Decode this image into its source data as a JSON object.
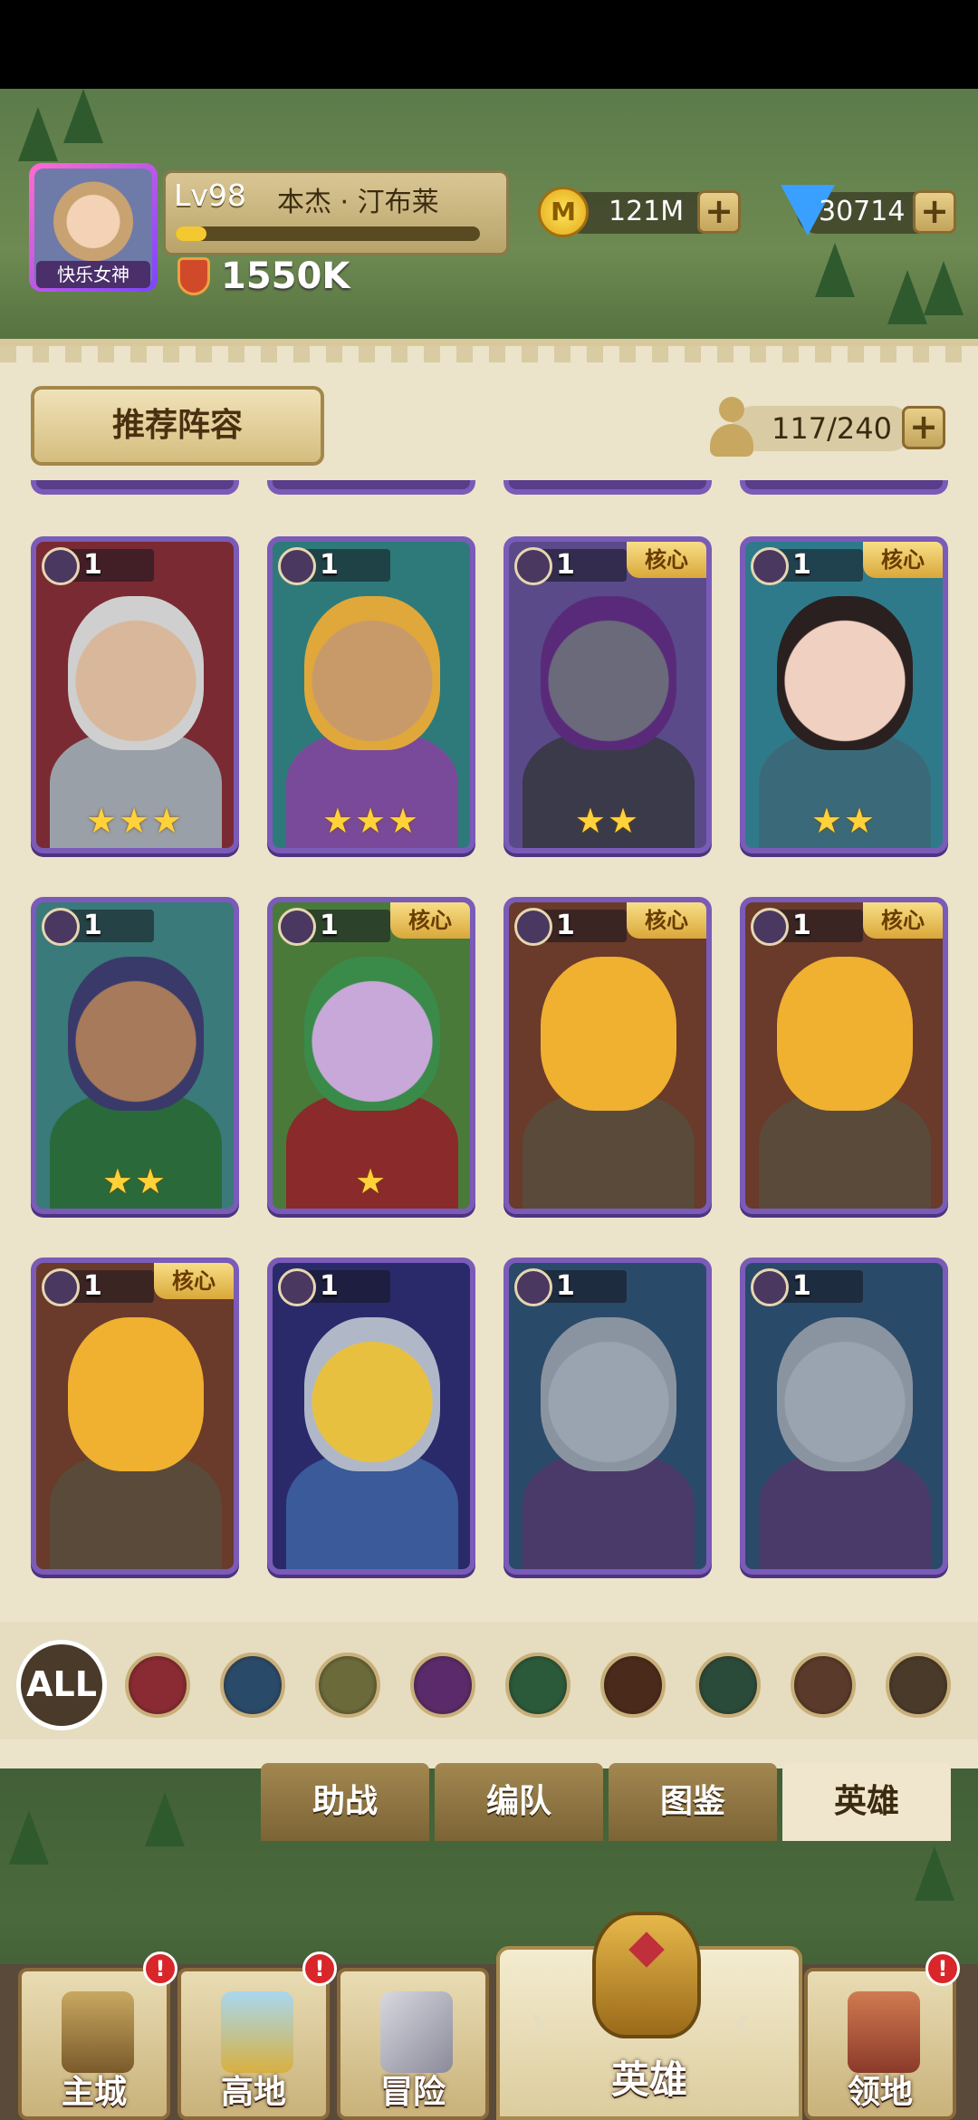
{
  "player": {
    "avatar_label": "快乐女神",
    "level": "Lv98",
    "name": "本杰 · 汀布莱",
    "xp_fraction": 0.1,
    "power": "1550K"
  },
  "resources": {
    "gold": "121M",
    "gold_icon_letter": "M",
    "gems": "30714",
    "plus": "+"
  },
  "panel": {
    "recommend_label": "推荐阵容",
    "hero_count": "117/240",
    "plus": "+"
  },
  "heroes": [
    {
      "level": "1",
      "class_icon": "shield-icon",
      "core": "",
      "stars": "★★★",
      "portrait": "grey-haired-knight",
      "bg": "#7a2a32",
      "skin": "#d8b79a",
      "outfit": "#9aa0a8",
      "hair": "#cfcfcf"
    },
    {
      "level": "1",
      "class_icon": "staff-icon",
      "core": "",
      "stars": "★★★",
      "portrait": "blonde-mage",
      "bg": "#2e7a7a",
      "skin": "#c89a6a",
      "outfit": "#7a4a9a",
      "hair": "#e0a83a"
    },
    {
      "level": "1",
      "class_icon": "shield-icon",
      "core": "核心",
      "stars": "★★",
      "portrait": "horned-dark-knight",
      "bg": "#5a4a8a",
      "skin": "#6a6a7a",
      "outfit": "#3a3a4a",
      "hair": "#5a2a7a"
    },
    {
      "level": "1",
      "class_icon": "staff-icon",
      "core": "核心",
      "stars": "★★",
      "portrait": "dark-haired-sorceress",
      "bg": "#2f7a8a",
      "skin": "#f0d0c0",
      "outfit": "#3a6a7a",
      "hair": "#2a2020"
    },
    {
      "level": "1",
      "class_icon": "staff-icon",
      "core": "",
      "stars": "★★",
      "portrait": "purple-haired-mage",
      "bg": "#3a7a7a",
      "skin": "#a67a5a",
      "outfit": "#2a6a3a",
      "hair": "#3a3a6a"
    },
    {
      "level": "1",
      "class_icon": "bow-icon",
      "core": "核心",
      "stars": "★",
      "portrait": "elf-archer",
      "bg": "#4a7a3a",
      "skin": "#c7a8d8",
      "outfit": "#8a2a2a",
      "hair": "#3a8a4a"
    },
    {
      "level": "1",
      "class_icon": "shield-icon",
      "core": "核心",
      "stars": "",
      "portrait": "yellow-creature",
      "bg": "#6a3a2a",
      "skin": "#f0b030",
      "outfit": "#5a4a3a",
      "hair": "#f0b030"
    },
    {
      "level": "1",
      "class_icon": "shield-icon",
      "core": "核心",
      "stars": "",
      "portrait": "yellow-creature",
      "bg": "#6a3a2a",
      "skin": "#f0b030",
      "outfit": "#5a4a3a",
      "hair": "#f0b030"
    },
    {
      "level": "1",
      "class_icon": "shield-icon",
      "core": "核心",
      "stars": "",
      "portrait": "yellow-creature",
      "bg": "#6a3a2a",
      "skin": "#f0b030",
      "outfit": "#5a4a3a",
      "hair": "#f0b030"
    },
    {
      "level": "1",
      "class_icon": "shield-icon",
      "core": "",
      "stars": "",
      "portrait": "armored-bull-knight",
      "bg": "#2a2a6a",
      "skin": "#e8c040",
      "outfit": "#3a5a9a",
      "hair": "#b0b8c8"
    },
    {
      "level": "1",
      "class_icon": "shield-icon",
      "core": "",
      "stars": "",
      "portrait": "grey-skinned-warrior",
      "bg": "#2a4a6a",
      "skin": "#9aa4b0",
      "outfit": "#4a3a6a",
      "hair": "#8a94a0"
    },
    {
      "level": "1",
      "class_icon": "shield-icon",
      "core": "",
      "stars": "",
      "portrait": "grey-skinned-warrior",
      "bg": "#2a4a6a",
      "skin": "#9aa4b0",
      "outfit": "#4a3a6a",
      "hair": "#8a94a0"
    }
  ],
  "filters": {
    "all_label": "ALL",
    "items": [
      {
        "name": "shield-filter-icon",
        "color": "#8a2a32"
      },
      {
        "name": "staff-filter-icon",
        "color": "#2a4a6a"
      },
      {
        "name": "holy-filter-icon",
        "color": "#6a6a3a"
      },
      {
        "name": "skull-filter-icon",
        "color": "#5a2a6a"
      },
      {
        "name": "crossed-swords-filter-icon",
        "color": "#2a5a3a"
      },
      {
        "name": "paw-filter-icon",
        "color": "#4a2a1a"
      },
      {
        "name": "bow-filter-icon",
        "color": "#2a4a3a"
      },
      {
        "name": "bull-filter-icon",
        "color": "#5a3a2a"
      },
      {
        "name": "hammer-filter-icon",
        "color": "#4a3a2a"
      }
    ]
  },
  "tabs": [
    {
      "label": "助战",
      "active": false
    },
    {
      "label": "编队",
      "active": false
    },
    {
      "label": "图鉴",
      "active": false
    },
    {
      "label": "英雄",
      "active": true
    }
  ],
  "bottom_nav": {
    "items": [
      {
        "label": "主城",
        "alert": "!",
        "icon": "castle-icon"
      },
      {
        "label": "高地",
        "alert": "!",
        "icon": "highland-icon"
      },
      {
        "label": "冒险",
        "alert": "",
        "icon": "crossed-swords-icon"
      }
    ],
    "active": {
      "label": "英雄",
      "icon": "helmet-icon"
    },
    "last": {
      "label": "领地",
      "alert": "!",
      "icon": "territory-icon"
    }
  }
}
